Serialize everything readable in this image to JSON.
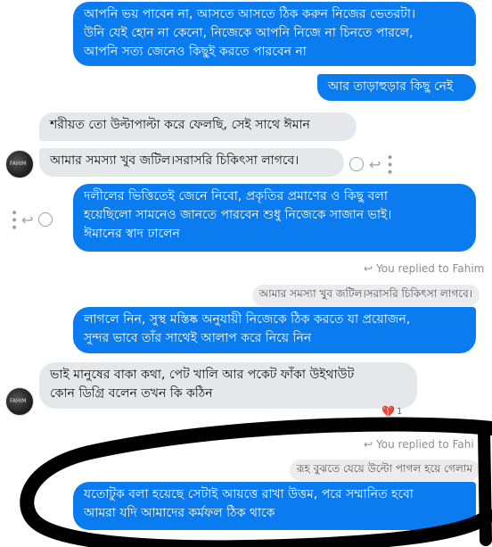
{
  "messages": {
    "m1": "আপনি ভয় পাবেন না, আসতে আসতে ঠিক করুন নিজের ভেতরটা।\nউনি যেই হোন না কেনো, নিজেকে আপনি নিজে না চিনতে পারলে,\nআপনি সত্য জেনেও কিছুই করতে পারবেন না",
    "m2": "আর তাড়াহুড়ার কিছু নেই",
    "m3": "শরীয়ত তো উল্টাপাল্টা করে ফেলছি, সেই সাথে ঈমান",
    "m4": "আমার সমস্যা খুব জটিল।সরাসরি চিকিৎসা লাগবে।",
    "m5": "দলীলের ভিত্তিতেই জেনে নিবো, প্রকৃতির প্রমাণের ও কিছু বলা\nহয়েছিলো সামনেও জানতে পারবেন শুধু নিজেকে সাজান ভাই।\nঈমানের স্বাদ ঢালেন",
    "m6": "লাগলে নিন, সুস্থ মস্তিষ্ক অনুযায়ী নিজেকে ঠিক করতে যা প্রয়োজন,\nসুন্দর ভাবে তাঁর সাথেই আলাপ করে নিয়ে নিন",
    "m7": "ভাই মানুষের বাকা কথা, পেট খালি আর পকেট ফাঁকা উইথাউট\nকোন ডিগ্রি বলেন তখন কি কঠিন",
    "m8": "যতোটুক বলা হয়েছে সেটাই আয়ত্তে রাখা উত্তম, পরে সম্মানিত হবো\nআমরা যদি আমাদের কর্মফল ঠিক থাকে"
  },
  "replies": {
    "r1_label": "You replied to Fahim",
    "r1_quote": "আমার সমস্যা খুব জটিল।সরাসরি চিকিৎসা লাগবে।",
    "r2_label": "You replied to Fahi",
    "r2_quote": "রূহ বুঝতে যেয়ে উল্টো পাগল হয়ে গেলাম"
  },
  "reaction": {
    "emoji": "💔",
    "count": "1"
  },
  "avatar_text": "FAHIM",
  "colors": {
    "outgoing": "#0a7cf0",
    "incoming": "#e6e7ea",
    "annotation": "#000000"
  }
}
